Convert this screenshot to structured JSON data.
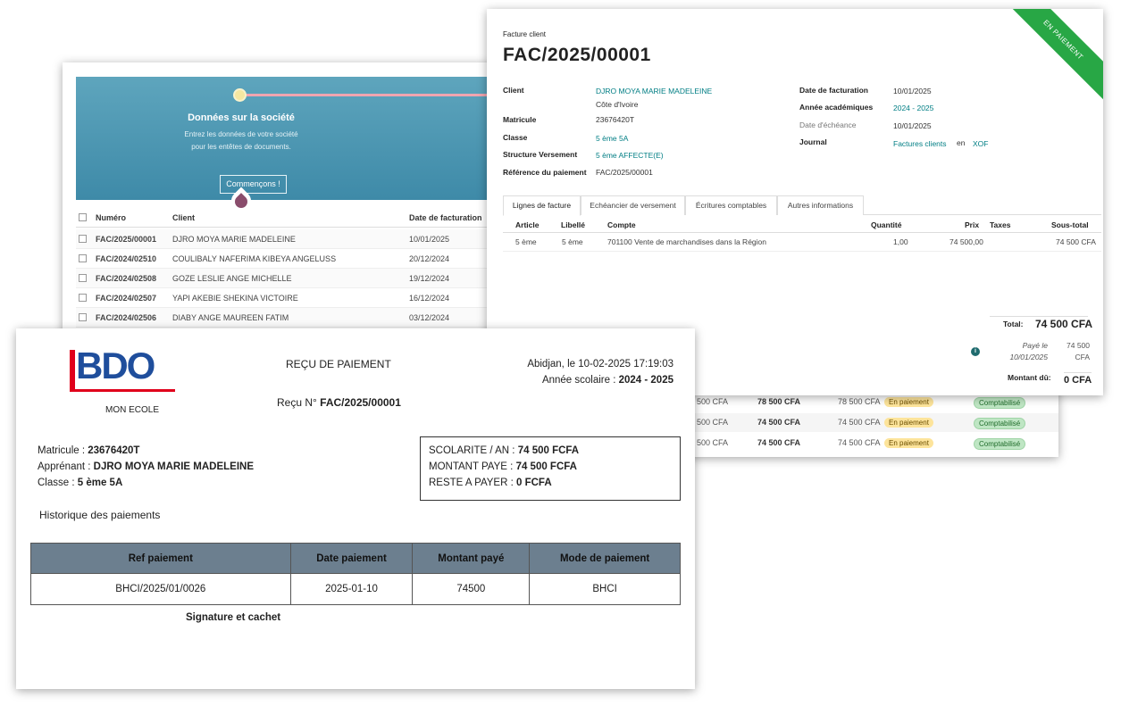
{
  "list_view": {
    "onboarding": {
      "title": "Données sur la société",
      "subtitle_line1": "Entrez les données de votre société",
      "subtitle_line2": "pour les entêtes de documents.",
      "button": "Commençons !"
    },
    "columns": [
      "Numéro",
      "Client",
      "Date de facturation"
    ],
    "rows": [
      {
        "num": "FAC/2025/00001",
        "client": "DJRO MOYA MARIE MADELEINE",
        "date": "10/01/2025"
      },
      {
        "num": "FAC/2024/02510",
        "client": "COULIBALY NAFERIMA KIBEYA ANGELUSS",
        "date": "20/12/2024"
      },
      {
        "num": "FAC/2024/02508",
        "client": "GOZE LESLIE ANGE MICHELLE",
        "date": "19/12/2024"
      },
      {
        "num": "FAC/2024/02507",
        "client": "YAPI AKEBIE SHEKINA VICTOIRE",
        "date": "16/12/2024"
      },
      {
        "num": "FAC/2024/02506",
        "client": "DIABY ANGE MAUREEN FATIM",
        "date": "03/12/2024"
      }
    ]
  },
  "back_table": {
    "rows": [
      {
        "a": "500 CFA",
        "b": "78 500 CFA",
        "c": "78 500 CFA",
        "status": "En paiement",
        "state": "Comptabilisé"
      },
      {
        "a": "500 CFA",
        "b": "74 500 CFA",
        "c": "74 500 CFA",
        "status": "En paiement",
        "state": "Comptabilisé"
      },
      {
        "a": "500 CFA",
        "b": "74 500 CFA",
        "c": "74 500 CFA",
        "status": "En paiement",
        "state": "Comptabilisé"
      }
    ]
  },
  "invoice": {
    "ribbon": "EN PAIEMENT",
    "type_label": "Facture client",
    "number": "FAC/2025/00001",
    "left_fields": {
      "client_label": "Client",
      "client_value": "DJRO MOYA MARIE MADELEINE",
      "client_country": "Côte d'Ivoire",
      "matricule_label": "Matricule",
      "matricule_value": "23676420T",
      "classe_label": "Classe",
      "classe_value": "5 ème 5A",
      "structure_label": "Structure Versement",
      "structure_value": "5 ème AFFECTE(E)",
      "reference_label": "Référence du paiement",
      "reference_value": "FAC/2025/00001"
    },
    "right_fields": {
      "date_label": "Date de facturation",
      "date_value": "10/01/2025",
      "annee_label": "Année académiques",
      "annee_value": "2024 - 2025",
      "echeance_label": "Date d'échéance",
      "echeance_value": "10/01/2025",
      "journal_label": "Journal",
      "journal_value": "Factures clients",
      "journal_en": "en",
      "journal_currency": "XOF"
    },
    "tabs": [
      "Lignes de facture",
      "Echéancier de versement",
      "Écritures comptables",
      "Autres informations"
    ],
    "line_columns": {
      "article": "Article",
      "libelle": "Libellé",
      "compte": "Compte",
      "quantite": "Quantité",
      "prix": "Prix",
      "taxes": "Taxes",
      "sous_total": "Sous-total"
    },
    "line": {
      "article": "5 ème",
      "libelle": "5 ème",
      "compte": "701100 Vente de marchandises dans la Région",
      "quantite": "1,00",
      "prix": "74 500,00",
      "sous_total": "74 500 CFA"
    },
    "totals": {
      "total_label": "Total:",
      "total_value": "74 500 CFA",
      "paid_label_1": "Payé le",
      "paid_label_2": "10/01/2025",
      "paid_value_1": "74 500",
      "paid_value_2": "CFA",
      "due_label": "Montant dû:",
      "due_value": "0 CFA"
    }
  },
  "receipt": {
    "logo_text": "BDO",
    "school": "MON ECOLE",
    "title": "REÇU DE PAIEMENT",
    "receipt_no_label": "Reçu N°",
    "receipt_no_value": "FAC/2025/00001",
    "place_date": "Abidjan, le 10-02-2025 17:19:03",
    "year_label": "Année scolaire :",
    "year_value": "2024 - 2025",
    "matricule_label": "Matricule :",
    "matricule_value": "23676420T",
    "apprenant_label": "Apprénant :",
    "apprenant_value": "DJRO MOYA MARIE MADELEINE",
    "classe_label": "Classe :",
    "classe_value": "5 ème 5A",
    "scolarite_label": "SCOLARITE / AN :",
    "scolarite_value": "74 500 FCFA",
    "montant_paye_label": "MONTANT PAYE :",
    "montant_paye_value": "74 500 FCFA",
    "reste_label": "RESTE A PAYER :",
    "reste_value": "0 FCFA",
    "history_title": "Historique des paiements",
    "table_headers": [
      "Ref paiement",
      "Date paiement",
      "Montant payé",
      "Mode de paiement"
    ],
    "table_rows": [
      [
        "BHCI/2025/01/0026",
        "2025-01-10",
        "74500",
        "BHCI"
      ]
    ],
    "signature": "Signature et cachet"
  },
  "colors": {
    "link": "#017e84",
    "ribbon": "#28a745",
    "bdo_blue": "#1f4e9c",
    "bdo_red": "#e0001b",
    "table_header": "#6c7f8f"
  }
}
